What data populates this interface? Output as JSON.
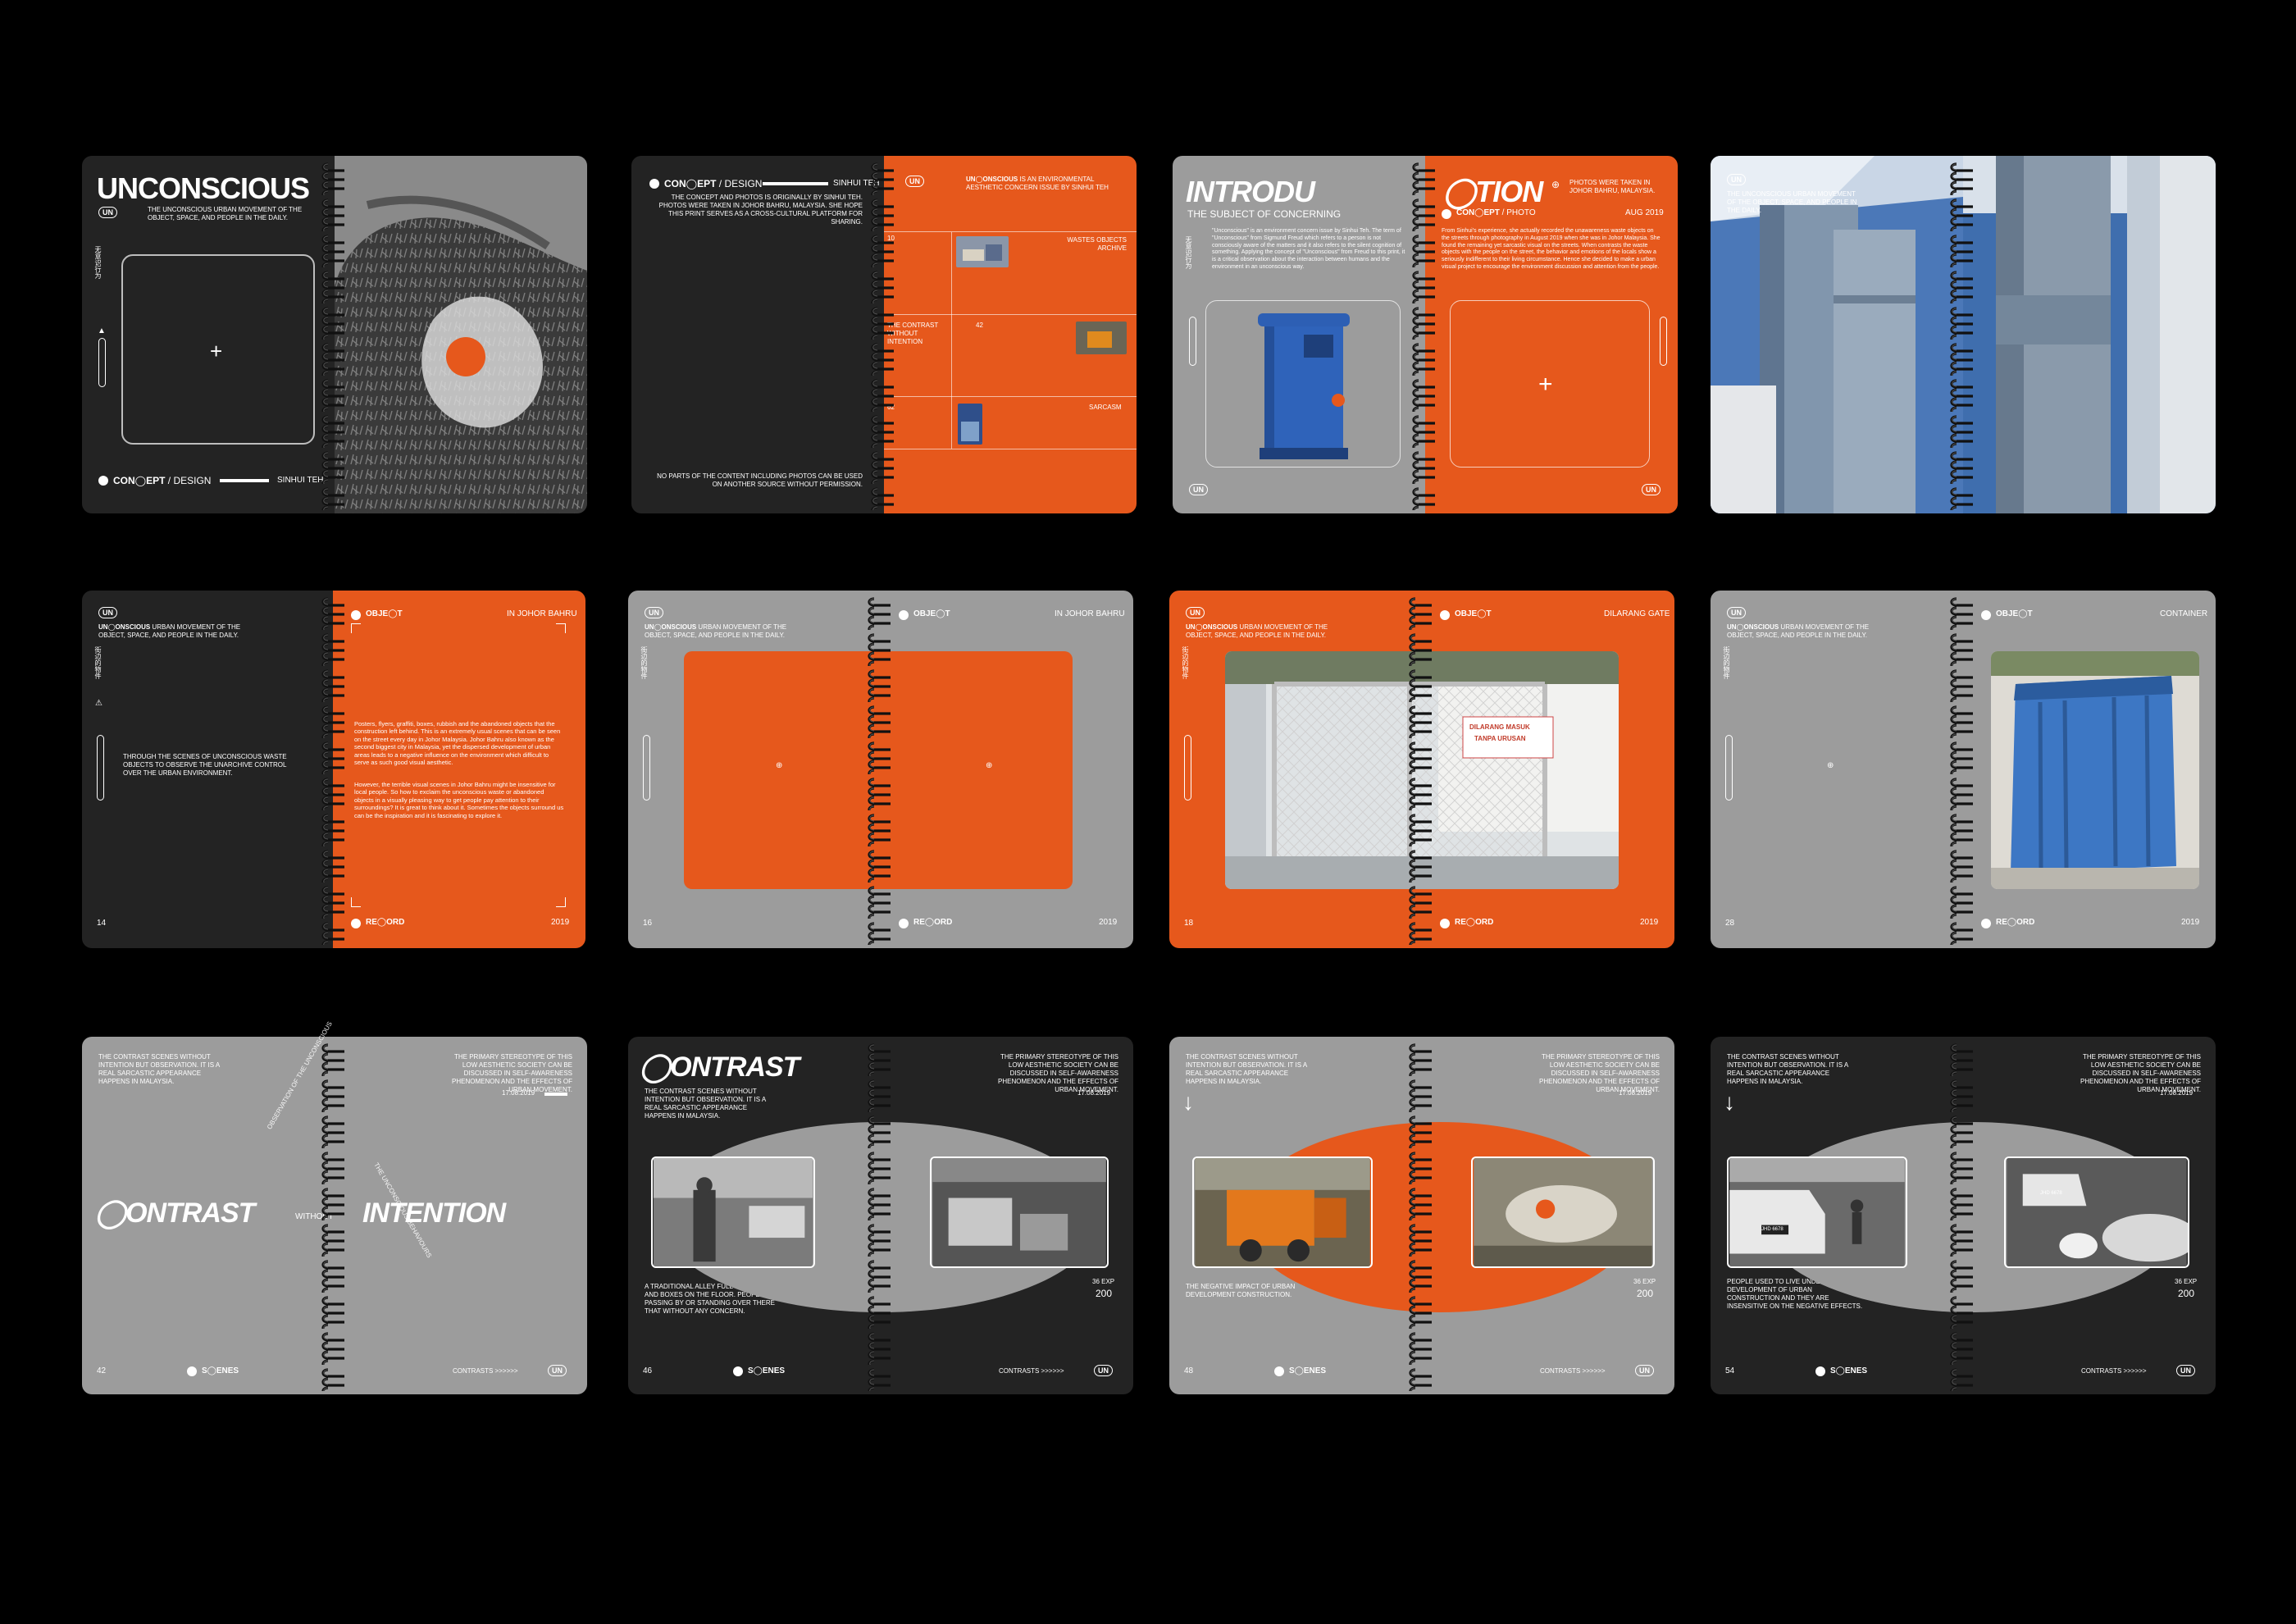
{
  "colors": {
    "orange": "#e6581c",
    "dark": "#232323",
    "grey": "#9c9c9c",
    "black": "#000000"
  },
  "brand": {
    "logo": "UN",
    "chinese_title": "无意识行为",
    "chinese_object": "街边的物件"
  },
  "s1": {
    "title": "UNCONSCIOUS",
    "tagline": "THE UNCONSCIOUS URBAN MOVEMENT OF THE OBJECT, SPACE, AND PEOPLE IN THE DAILY.",
    "section_a": "CON",
    "section_b": "EPT",
    "section_c": "/ DESIGN",
    "author": "SINHUI TEH"
  },
  "s2": {
    "section_a": "CON",
    "section_b": "EPT",
    "section_c": "/ DESIGN",
    "author": "SINHUI TEH",
    "concept_text": "THE CONCEPT AND PHOTOS IS ORIGINALLY BY SINHUI TEH. PHOTOS WERE TAKEN IN JOHOR BAHRU, MALAYSIA. SHE HOPE THIS PRINT SERVES AS A CROSS-CULTURAL PLATFORM FOR SHARING.",
    "permission_text": "NO PARTS OF THE CONTENT INCLUDING PHOTOS CAN BE USED ON ANOTHER SOURCE WITHOUT PERMISSION.",
    "about_a": "UN",
    "about_b": "ONSCIOUS",
    "about_text": "IS AN ENVIRONMENTAL AESTHETIC CONCERN ISSUE BY SINHUI TEH",
    "archive_label": "WASTES OBJECTS ARCHIVE",
    "contrast_label": "THE CONTRAST WITHOUT INTENTION",
    "sarcasm_label": "SARCASM",
    "num_a": "10",
    "num_b": "42",
    "num_c": "62"
  },
  "s3": {
    "title_left": "INTRODU",
    "title_right": "TION",
    "subtitle": "THE SUBJECT OF CONCERNING",
    "section_a": "CON",
    "section_b": "EPT",
    "section_c": "/ PHOTO",
    "date": "AUG 2019",
    "location_text": "PHOTOS WERE TAKEN IN JOHOR BAHRU, MALAYSIA.",
    "intro_text": "\"Unconscious\" is an environment concern issue by Sinhui Teh. The term of \"Unconscious\" from Sigmund Freud which refers to a person is not consciously aware of the matters and it also refers to the silent cognition of something. Applying the concept of \"Unconscious\" from Freud to this print, it is a critical observation about the interaction between humans and the environment in an unconscious way.",
    "story_text": "From Sinhui's experience, she actually recorded the unawareness waste objects on the streets through photography in August 2019 when she was in Johor Malaysia. She found the remaining yet sarcastic visual on the streets. When contrasts the waste objects with the people on the street, the behavior and emotions of the locals show a seriously indifferent to their living circumstance. Hence she decided to make a urban visual project to encourage the environment discussion and attention from the people."
  },
  "s5": {
    "tagline_a": "UN",
    "tagline_b": "ONSCIOUS",
    "tagline": "URBAN MOVEMENT OF THE OBJECT, SPACE, AND PEOPLE IN THE DAILY.",
    "section_a": "OBJE",
    "section_b": "T",
    "location": "IN JOHOR BAHRU",
    "scenes_text": "THROUGH THE SCENES OF UNCONSCIOUS WASTE OBJECTS TO OBSERVE THE UNARCHIVE CONTROL OVER THE URBAN ENVIRONMENT.",
    "body_1": "Posters, flyers, graffiti, boxes, rubbish and the abandoned objects that the construction left behind. This is an extremely usual scenes that can be seen on the street every day in Johor Malaysia. Johor Bahru also known as the second biggest city in Malaysia, yet the dispersed development of urban areas leads to a negative influence on the environment which difficult to serve as such good visual aesthetic.",
    "body_2": "However, the terrible visual scenes in Johor Bahru might be insensitive for local people. So how to exclaim the unconscious waste or abandoned objects in a visually pleasing way to get people pay attention to their surroundings? It is great to think about it. Sometimes the objects surround us can be the inspiration and it is fascinating to explore it.",
    "footer_a": "RE",
    "footer_b": "ORD",
    "page": "14",
    "year": "2019"
  },
  "s6": {
    "location": "IN JOHOR BAHRU",
    "page": "16",
    "year": "2019"
  },
  "s7": {
    "location": "DILARANG GATE",
    "page": "18",
    "year": "2019",
    "sign_1": "DILARANG MASUK",
    "sign_2": "TANPA URUSAN"
  },
  "s8": {
    "location": "CONTAINER",
    "page": "28",
    "year": "2019"
  },
  "row3": {
    "scenes_a": "THE CONTRAST SCENES WITHOUT INTENTION BUT OBSERVATION. IT IS A REAL SARCASTIC APPEARANCE HAPPENS IN MALAYSIA.",
    "scenes_b": "THE PRIMARY STEREOTYPE OF THIS LOW AESTHETIC SOCIETY CAN BE DISCUSSED IN SELF-AWARENESS PHENOMENON AND THE EFFECTS OF URBAN MOVEMENT.",
    "date": "17.08.2019",
    "footer_a": "S",
    "footer_b": "ENES",
    "contrasts": "CONTRASTS >>>>>>",
    "exp": "36 EXP",
    "iso": "200"
  },
  "s9": {
    "title_left": "ONTRAST",
    "title_mid": "WITHOUT",
    "title_right": "INTENTION",
    "page": "42",
    "arc_a": "OBSERVATION OF THE UNCONSCIOUS",
    "arc_b": "THE UNCONSCIOUS BEHAVIOURS"
  },
  "s10": {
    "title": "ONTRAST",
    "page": "46",
    "caption": "A TRADITIONAL ALLEY FULL OF RUBBISH AND BOXES ON THE FLOOR. PEOPLE ARE PASSING BY OR STANDING OVER THERE THAT WITHOUT ANY CONCERN."
  },
  "s11": {
    "page": "48",
    "caption": "THE NEGATIVE IMPACT OF URBAN DEVELOPMENT CONSTRUCTION."
  },
  "s12": {
    "page": "54",
    "caption": "PEOPLE USED TO LIVE UNDER THE DEVELOPMENT OF URBAN CONSTRUCTION AND THEY ARE INSENSITIVE ON THE NEGATIVE EFFECTS.",
    "plate_1": "JHD 6678",
    "plate_2": "JHD 6678"
  }
}
